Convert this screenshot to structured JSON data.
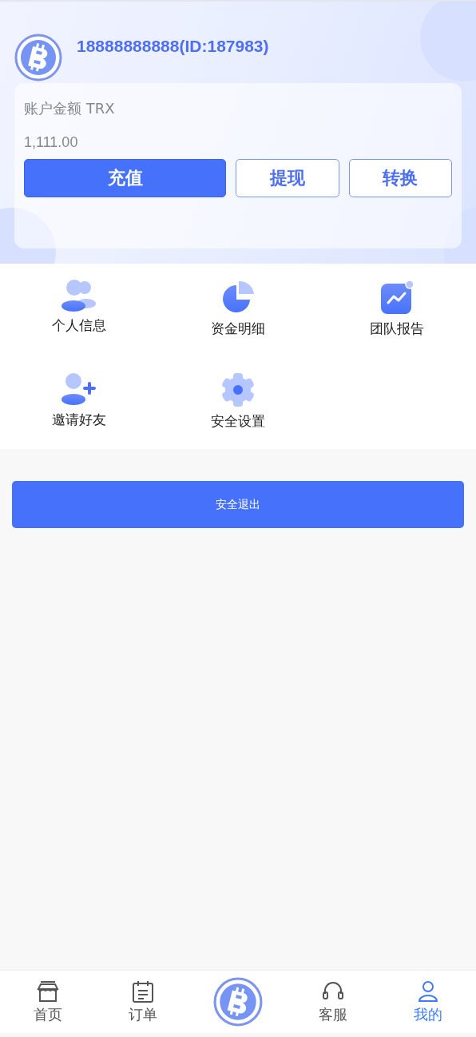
{
  "user": {
    "name": "18888888888(ID:187983)"
  },
  "account": {
    "label": "账户金额 TRX",
    "amount": "1,111.00",
    "buttons": [
      {
        "label": "充值",
        "kind": "primary"
      },
      {
        "label": "提现",
        "kind": "outline"
      },
      {
        "label": "转换",
        "kind": "outline"
      }
    ]
  },
  "menu": [
    {
      "label": "个人信息",
      "kind": "users"
    },
    {
      "label": "资金明细",
      "kind": "pie"
    },
    {
      "label": "团队报告",
      "kind": "chart"
    },
    {
      "label": "邀请好友",
      "kind": "invite"
    },
    {
      "label": "安全设置",
      "kind": "gear"
    }
  ],
  "logout": {
    "label": "安全退出"
  },
  "tab_bar": [
    {
      "label": "首页",
      "kind": "shop",
      "selected": false
    },
    {
      "label": "订单",
      "kind": "order",
      "selected": false
    },
    {
      "kind": "coin"
    },
    {
      "label": "客服",
      "kind": "support",
      "selected": false
    },
    {
      "label": "我的",
      "kind": "user",
      "selected": true
    }
  ]
}
